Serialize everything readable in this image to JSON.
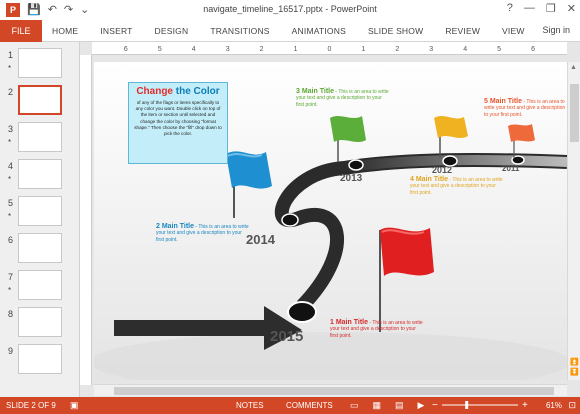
{
  "window": {
    "title": "navigate_timeline_16517.pptx - PowerPoint",
    "help": "?",
    "minimize": "—",
    "restore": "❐",
    "close": "✕"
  },
  "qat": {
    "save": "💾",
    "undo": "↶",
    "redo": "↷",
    "customize": "⌄"
  },
  "ribbon": {
    "file": "FILE",
    "tabs": [
      "HOME",
      "INSERT",
      "DESIGN",
      "TRANSITIONS",
      "ANIMATIONS",
      "SLIDE SHOW",
      "REVIEW",
      "VIEW"
    ],
    "signin": "Sign in"
  },
  "ruler": {
    "labels": [
      "6",
      "5",
      "4",
      "3",
      "2",
      "1",
      "0",
      "1",
      "2",
      "3",
      "4",
      "5",
      "6"
    ]
  },
  "thumbnails": [
    {
      "num": "1",
      "star": "*",
      "selected": false
    },
    {
      "num": "2",
      "star": "",
      "selected": true
    },
    {
      "num": "3",
      "star": "*",
      "selected": false
    },
    {
      "num": "4",
      "star": "*",
      "selected": false
    },
    {
      "num": "5",
      "star": "*",
      "selected": false
    },
    {
      "num": "6",
      "star": "",
      "selected": false
    },
    {
      "num": "7",
      "star": "*",
      "selected": false
    },
    {
      "num": "8",
      "star": "",
      "selected": false
    },
    {
      "num": "9",
      "star": "",
      "selected": false
    }
  ],
  "slide": {
    "callout": {
      "title_red": "Change",
      "title_blue": "the Color",
      "body": "of any of the flags or items specifically to any color you want. Double click on top of the item or section until selected and change the color by choosing \"format shape.\" Then choose the \"fill\" drop down to pick the color."
    },
    "years": {
      "y2015": "2015",
      "y2014": "2014",
      "y2013": "2013",
      "y2012": "2012",
      "y2011": "2011"
    },
    "items": [
      {
        "title": "1 Main Title",
        "text": " - This is an area to write your text and give a description to your first point.",
        "color": "#d62a2a"
      },
      {
        "title": "2 Main Title",
        "text": " - This is an area to write your text and give a description to your first point.",
        "color": "#1a86c2"
      },
      {
        "title": "3 Main Title",
        "text": " - This is an area to write your text and give a description to your first point.",
        "color": "#5aa832"
      },
      {
        "title": "4 Main Title",
        "text": " - This is an area to write your text and give a description to your first point.",
        "color": "#e0a421"
      },
      {
        "title": "5 Main Title",
        "text": " - This is an area to write your text and give a description to your first point.",
        "color": "#e8542b"
      }
    ]
  },
  "status": {
    "slide_info": "SLIDE 2 OF 9",
    "notes": "NOTES",
    "comments": "COMMENTS",
    "zoom": "61%",
    "zoom_minus": "−",
    "zoom_plus": "+"
  },
  "colors": {
    "accent": "#d24726",
    "callout_fill": "#c3eef9"
  }
}
